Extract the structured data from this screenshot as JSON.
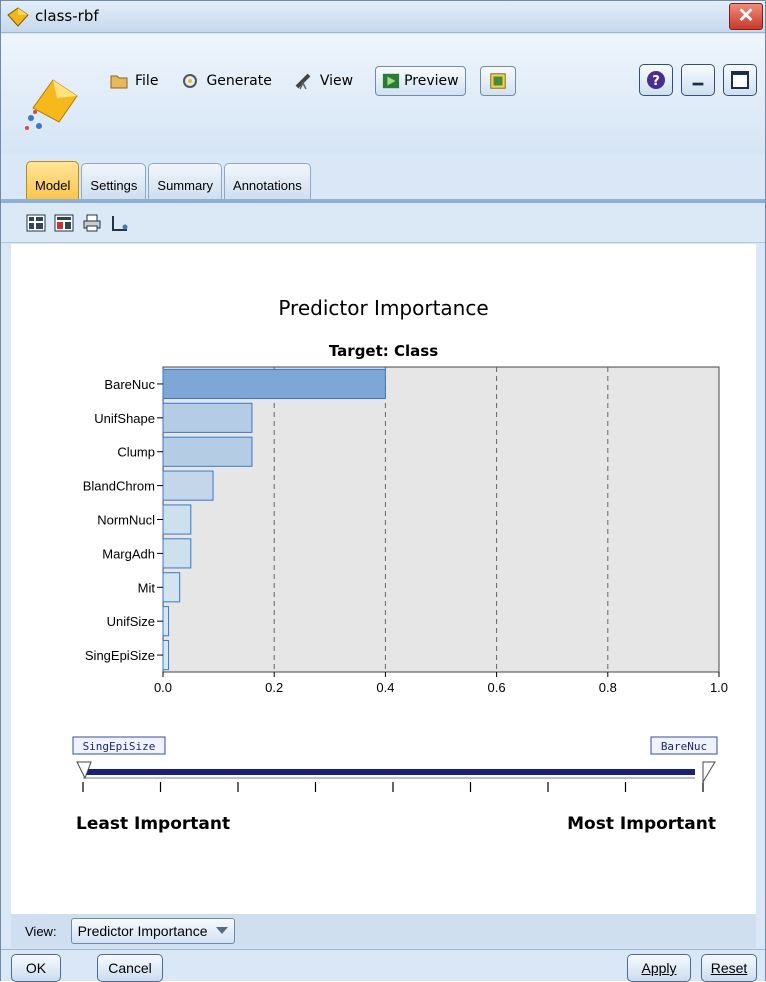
{
  "window": {
    "title": "class-rbf"
  },
  "toolbar": {
    "file_label": "File",
    "generate_label": "Generate",
    "view_label": "View",
    "preview_label": "Preview"
  },
  "tabs": [
    {
      "label": "Model",
      "active": true
    },
    {
      "label": "Settings",
      "active": false
    },
    {
      "label": "Summary",
      "active": false
    },
    {
      "label": "Annotations",
      "active": false
    }
  ],
  "chart_data": {
    "type": "bar",
    "orientation": "horizontal",
    "title": "Predictor Importance",
    "subtitle": "Target: Class",
    "categories": [
      "BareNuc",
      "UnifShape",
      "Clump",
      "BlandChrom",
      "NormNucl",
      "MargAdh",
      "Mit",
      "UnifSize",
      "SingEpiSize"
    ],
    "values": [
      0.4,
      0.16,
      0.16,
      0.09,
      0.05,
      0.05,
      0.03,
      0.01,
      0.01
    ],
    "xlim": [
      0.0,
      1.0
    ],
    "xticks": [
      "0.0",
      "0.2",
      "0.4",
      "0.6",
      "0.8",
      "1.0"
    ],
    "grid": true,
    "bar_colors": [
      "#7ea7d6",
      "#b4cde5",
      "#b4cde5",
      "#c4d7ea",
      "#cde0ee",
      "#cde0ee",
      "#d3e3f0",
      "#d8e6f2",
      "#d8e6f2"
    ],
    "plot_background": "#e6e6e6"
  },
  "slider": {
    "min_label": "SingEpiSize",
    "max_label": "BareNuc",
    "least_label": "Least Important",
    "most_label": "Most Important"
  },
  "view_row": {
    "label": "View:",
    "selected": "Predictor Importance"
  },
  "buttons": {
    "ok": "OK",
    "cancel": "Cancel",
    "apply": "Apply",
    "reset": "Reset"
  }
}
